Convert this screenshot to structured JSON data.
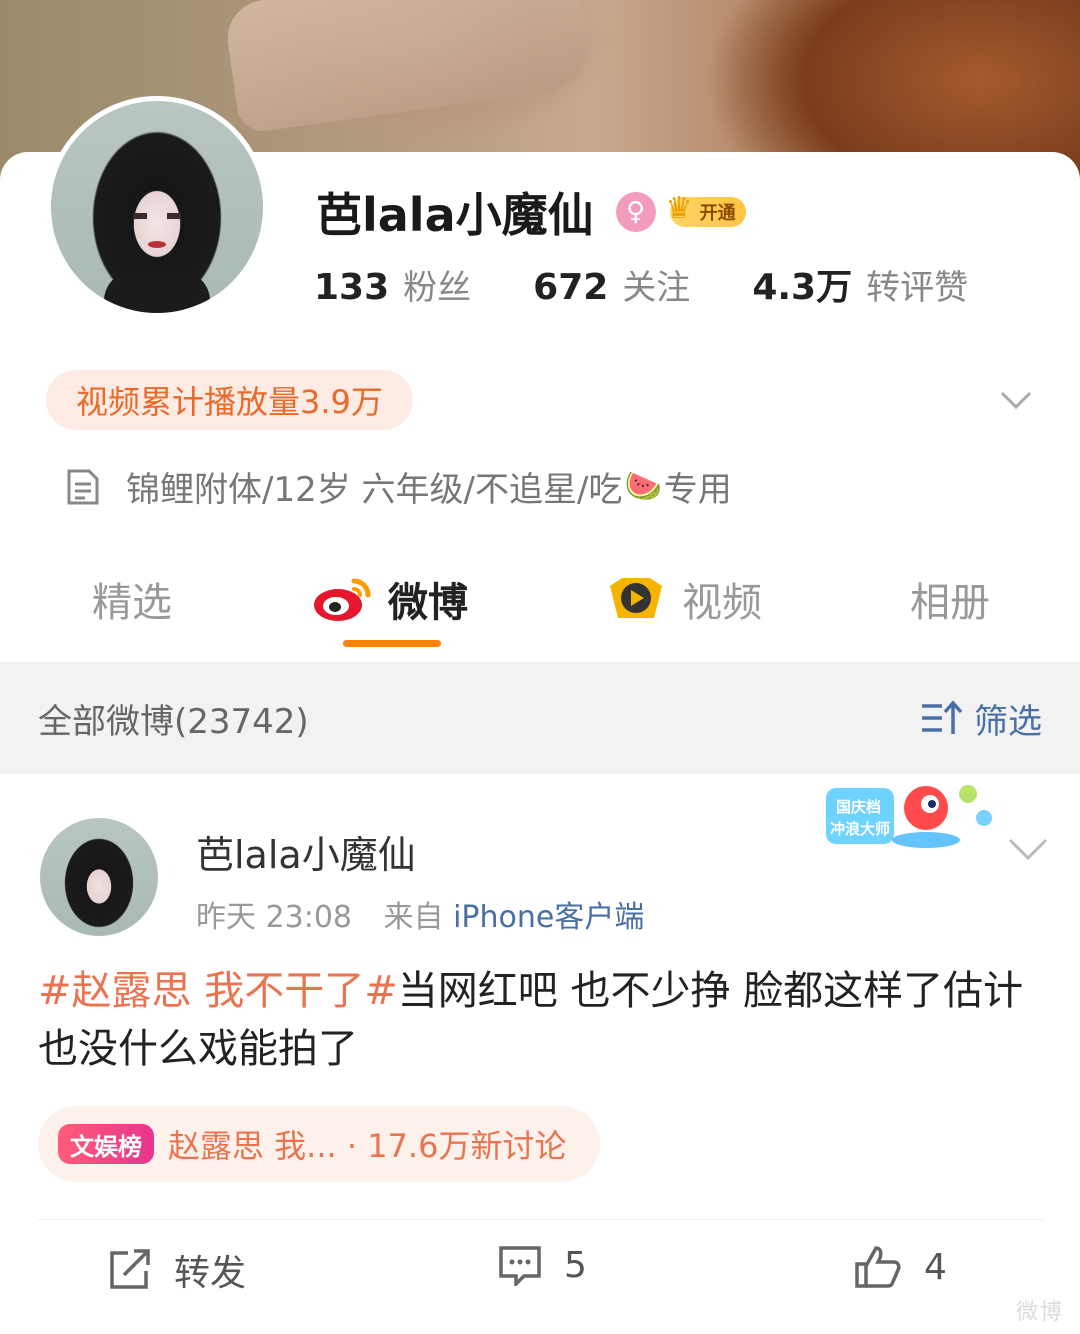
{
  "profile": {
    "name": "芭lala小魔仙",
    "vip_label": "开通",
    "stats": [
      {
        "num": "133",
        "label": "粉丝"
      },
      {
        "num": "672",
        "label": "关注"
      },
      {
        "num": "4.3万",
        "label": "转评赞"
      }
    ],
    "video_plays": "视频累计播放量3.9万",
    "bio_before": "锦鲤附体/12岁 六年级/不追星/吃",
    "bio_emoji": "🍉",
    "bio_after": "专用"
  },
  "tabs": [
    {
      "label": "精选"
    },
    {
      "label": "微博"
    },
    {
      "label": "视频"
    },
    {
      "label": "相册"
    }
  ],
  "filter_bar": {
    "count": "全部微博(23742)",
    "filter_label": "筛选"
  },
  "post": {
    "author": "芭lala小魔仙",
    "time": "昨天 23:08",
    "from_prefix": "来自",
    "source": "iPhone客户端",
    "hashtag": "#赵露思 我不干了#",
    "text": "当网红吧 也不少挣 脸都这样了估计也没什么戏能拍了",
    "sticker_text": "国庆档冲浪大师",
    "topic_badge": "文娱榜",
    "topic_text": "赵露思 我... · 17.6万新讨论",
    "actions": {
      "repost": "转发",
      "comment": "5",
      "like": "4"
    }
  },
  "watermark": "微博",
  "colors": {
    "accent": "#ff8200",
    "link": "#4a6fa5",
    "tag": "#eb7350"
  }
}
